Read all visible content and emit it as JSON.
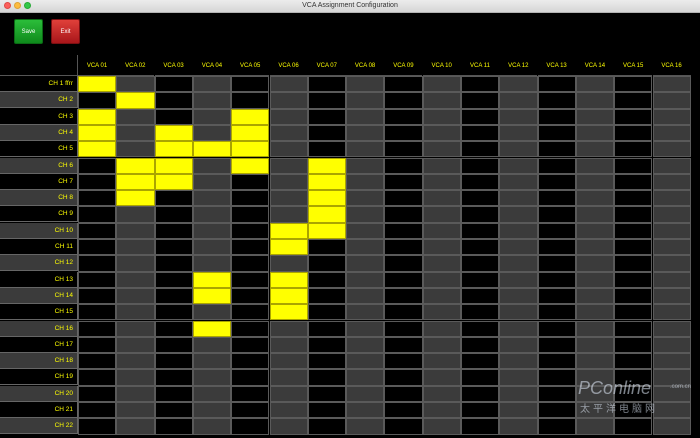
{
  "window": {
    "title": "VCA Assignment Configuration"
  },
  "toolbar": {
    "save_label": "Save",
    "exit_label": "Exit"
  },
  "colors": {
    "assigned": "#ffff00",
    "row_dark": "#000000",
    "row_light": "#3b3b3b",
    "label": "#ffff00"
  },
  "columns": [
    "VCA 01",
    "VCA 02",
    "VCA 03",
    "VCA 04",
    "VCA 05",
    "VCA 06",
    "VCA 07",
    "VCA 08",
    "VCA 09",
    "VCA 10",
    "VCA 11",
    "VCA 12",
    "VCA 13",
    "VCA 14",
    "VCA 15",
    "VCA 16"
  ],
  "rows": [
    "CH 1 ffrr",
    "CH 2",
    "CH 3",
    "CH 4",
    "CH 5",
    "CH 6",
    "CH 7",
    "CH 8",
    "CH 9",
    "CH 10",
    "CH 11",
    "CH 12",
    "CH 13",
    "CH 14",
    "CH 15",
    "CH 16",
    "CH 17",
    "CH 18",
    "CH 19",
    "CH 20",
    "CH 21",
    "CH 22"
  ],
  "assignments": [
    [
      1,
      0,
      0,
      0,
      0,
      0,
      0,
      0,
      0,
      0,
      0,
      0,
      0,
      0,
      0,
      0
    ],
    [
      0,
      1,
      0,
      0,
      0,
      0,
      0,
      0,
      0,
      0,
      0,
      0,
      0,
      0,
      0,
      0
    ],
    [
      1,
      0,
      0,
      0,
      1,
      0,
      0,
      0,
      0,
      0,
      0,
      0,
      0,
      0,
      0,
      0
    ],
    [
      1,
      0,
      1,
      0,
      1,
      0,
      0,
      0,
      0,
      0,
      0,
      0,
      0,
      0,
      0,
      0
    ],
    [
      1,
      0,
      1,
      1,
      1,
      0,
      0,
      0,
      0,
      0,
      0,
      0,
      0,
      0,
      0,
      0
    ],
    [
      0,
      1,
      1,
      0,
      1,
      0,
      1,
      0,
      0,
      0,
      0,
      0,
      0,
      0,
      0,
      0
    ],
    [
      0,
      1,
      1,
      0,
      0,
      0,
      1,
      0,
      0,
      0,
      0,
      0,
      0,
      0,
      0,
      0
    ],
    [
      0,
      1,
      0,
      0,
      0,
      0,
      1,
      0,
      0,
      0,
      0,
      0,
      0,
      0,
      0,
      0
    ],
    [
      0,
      0,
      0,
      0,
      0,
      0,
      1,
      0,
      0,
      0,
      0,
      0,
      0,
      0,
      0,
      0
    ],
    [
      0,
      0,
      0,
      0,
      0,
      1,
      1,
      0,
      0,
      0,
      0,
      0,
      0,
      0,
      0,
      0
    ],
    [
      0,
      0,
      0,
      0,
      0,
      1,
      0,
      0,
      0,
      0,
      0,
      0,
      0,
      0,
      0,
      0
    ],
    [
      0,
      0,
      0,
      0,
      0,
      0,
      0,
      0,
      0,
      0,
      0,
      0,
      0,
      0,
      0,
      0
    ],
    [
      0,
      0,
      0,
      1,
      0,
      1,
      0,
      0,
      0,
      0,
      0,
      0,
      0,
      0,
      0,
      0
    ],
    [
      0,
      0,
      0,
      1,
      0,
      1,
      0,
      0,
      0,
      0,
      0,
      0,
      0,
      0,
      0,
      0
    ],
    [
      0,
      0,
      0,
      0,
      0,
      1,
      0,
      0,
      0,
      0,
      0,
      0,
      0,
      0,
      0,
      0
    ],
    [
      0,
      0,
      0,
      1,
      0,
      0,
      0,
      0,
      0,
      0,
      0,
      0,
      0,
      0,
      0,
      0
    ],
    [
      0,
      0,
      0,
      0,
      0,
      0,
      0,
      0,
      0,
      0,
      0,
      0,
      0,
      0,
      0,
      0
    ],
    [
      0,
      0,
      0,
      0,
      0,
      0,
      0,
      0,
      0,
      0,
      0,
      0,
      0,
      0,
      0,
      0
    ],
    [
      0,
      0,
      0,
      0,
      0,
      0,
      0,
      0,
      0,
      0,
      0,
      0,
      0,
      0,
      0,
      0
    ],
    [
      0,
      0,
      0,
      0,
      0,
      0,
      0,
      0,
      0,
      0,
      0,
      0,
      0,
      0,
      0,
      0
    ],
    [
      0,
      0,
      0,
      0,
      0,
      0,
      0,
      0,
      0,
      0,
      0,
      0,
      0,
      0,
      0,
      0
    ],
    [
      0,
      0,
      0,
      0,
      0,
      0,
      0,
      0,
      0,
      0,
      0,
      0,
      0,
      0,
      0,
      0
    ]
  ],
  "watermark": {
    "logo": "PConline",
    "domain": ".com.cn",
    "cn_text": "太平洋电脑网"
  }
}
